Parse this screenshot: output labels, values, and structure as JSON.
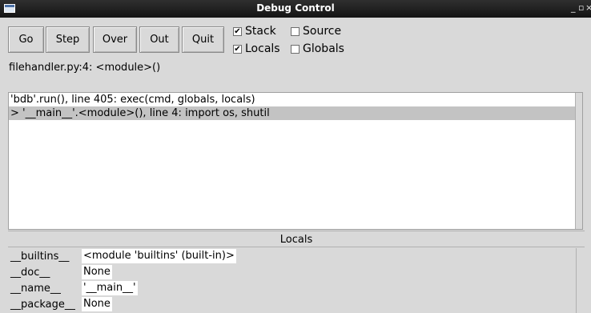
{
  "window": {
    "title": "Debug Control",
    "controls": "_ ▫ ×"
  },
  "toolbar": {
    "go": "Go",
    "step": "Step",
    "over": "Over",
    "out": "Out",
    "quit": "Quit"
  },
  "options": {
    "stack": {
      "label": "Stack",
      "checked": true
    },
    "source": {
      "label": "Source",
      "checked": false
    },
    "locals": {
      "label": "Locals",
      "checked": true
    },
    "globals": {
      "label": "Globals",
      "checked": false
    }
  },
  "status": "filehandler.py:4: <module>()",
  "stack_lines": [
    "'bdb'.run(), line 405: exec(cmd, globals, locals)",
    "> '__main__'.<module>(), line 4: import os, shutil"
  ],
  "locals": {
    "header": "Locals",
    "rows": [
      {
        "name": "__builtins__",
        "value": "<module 'builtins' (built-in)>"
      },
      {
        "name": "__doc__",
        "value": "None"
      },
      {
        "name": "__name__",
        "value": "'__main__'"
      },
      {
        "name": "__package__",
        "value": "None"
      }
    ]
  }
}
